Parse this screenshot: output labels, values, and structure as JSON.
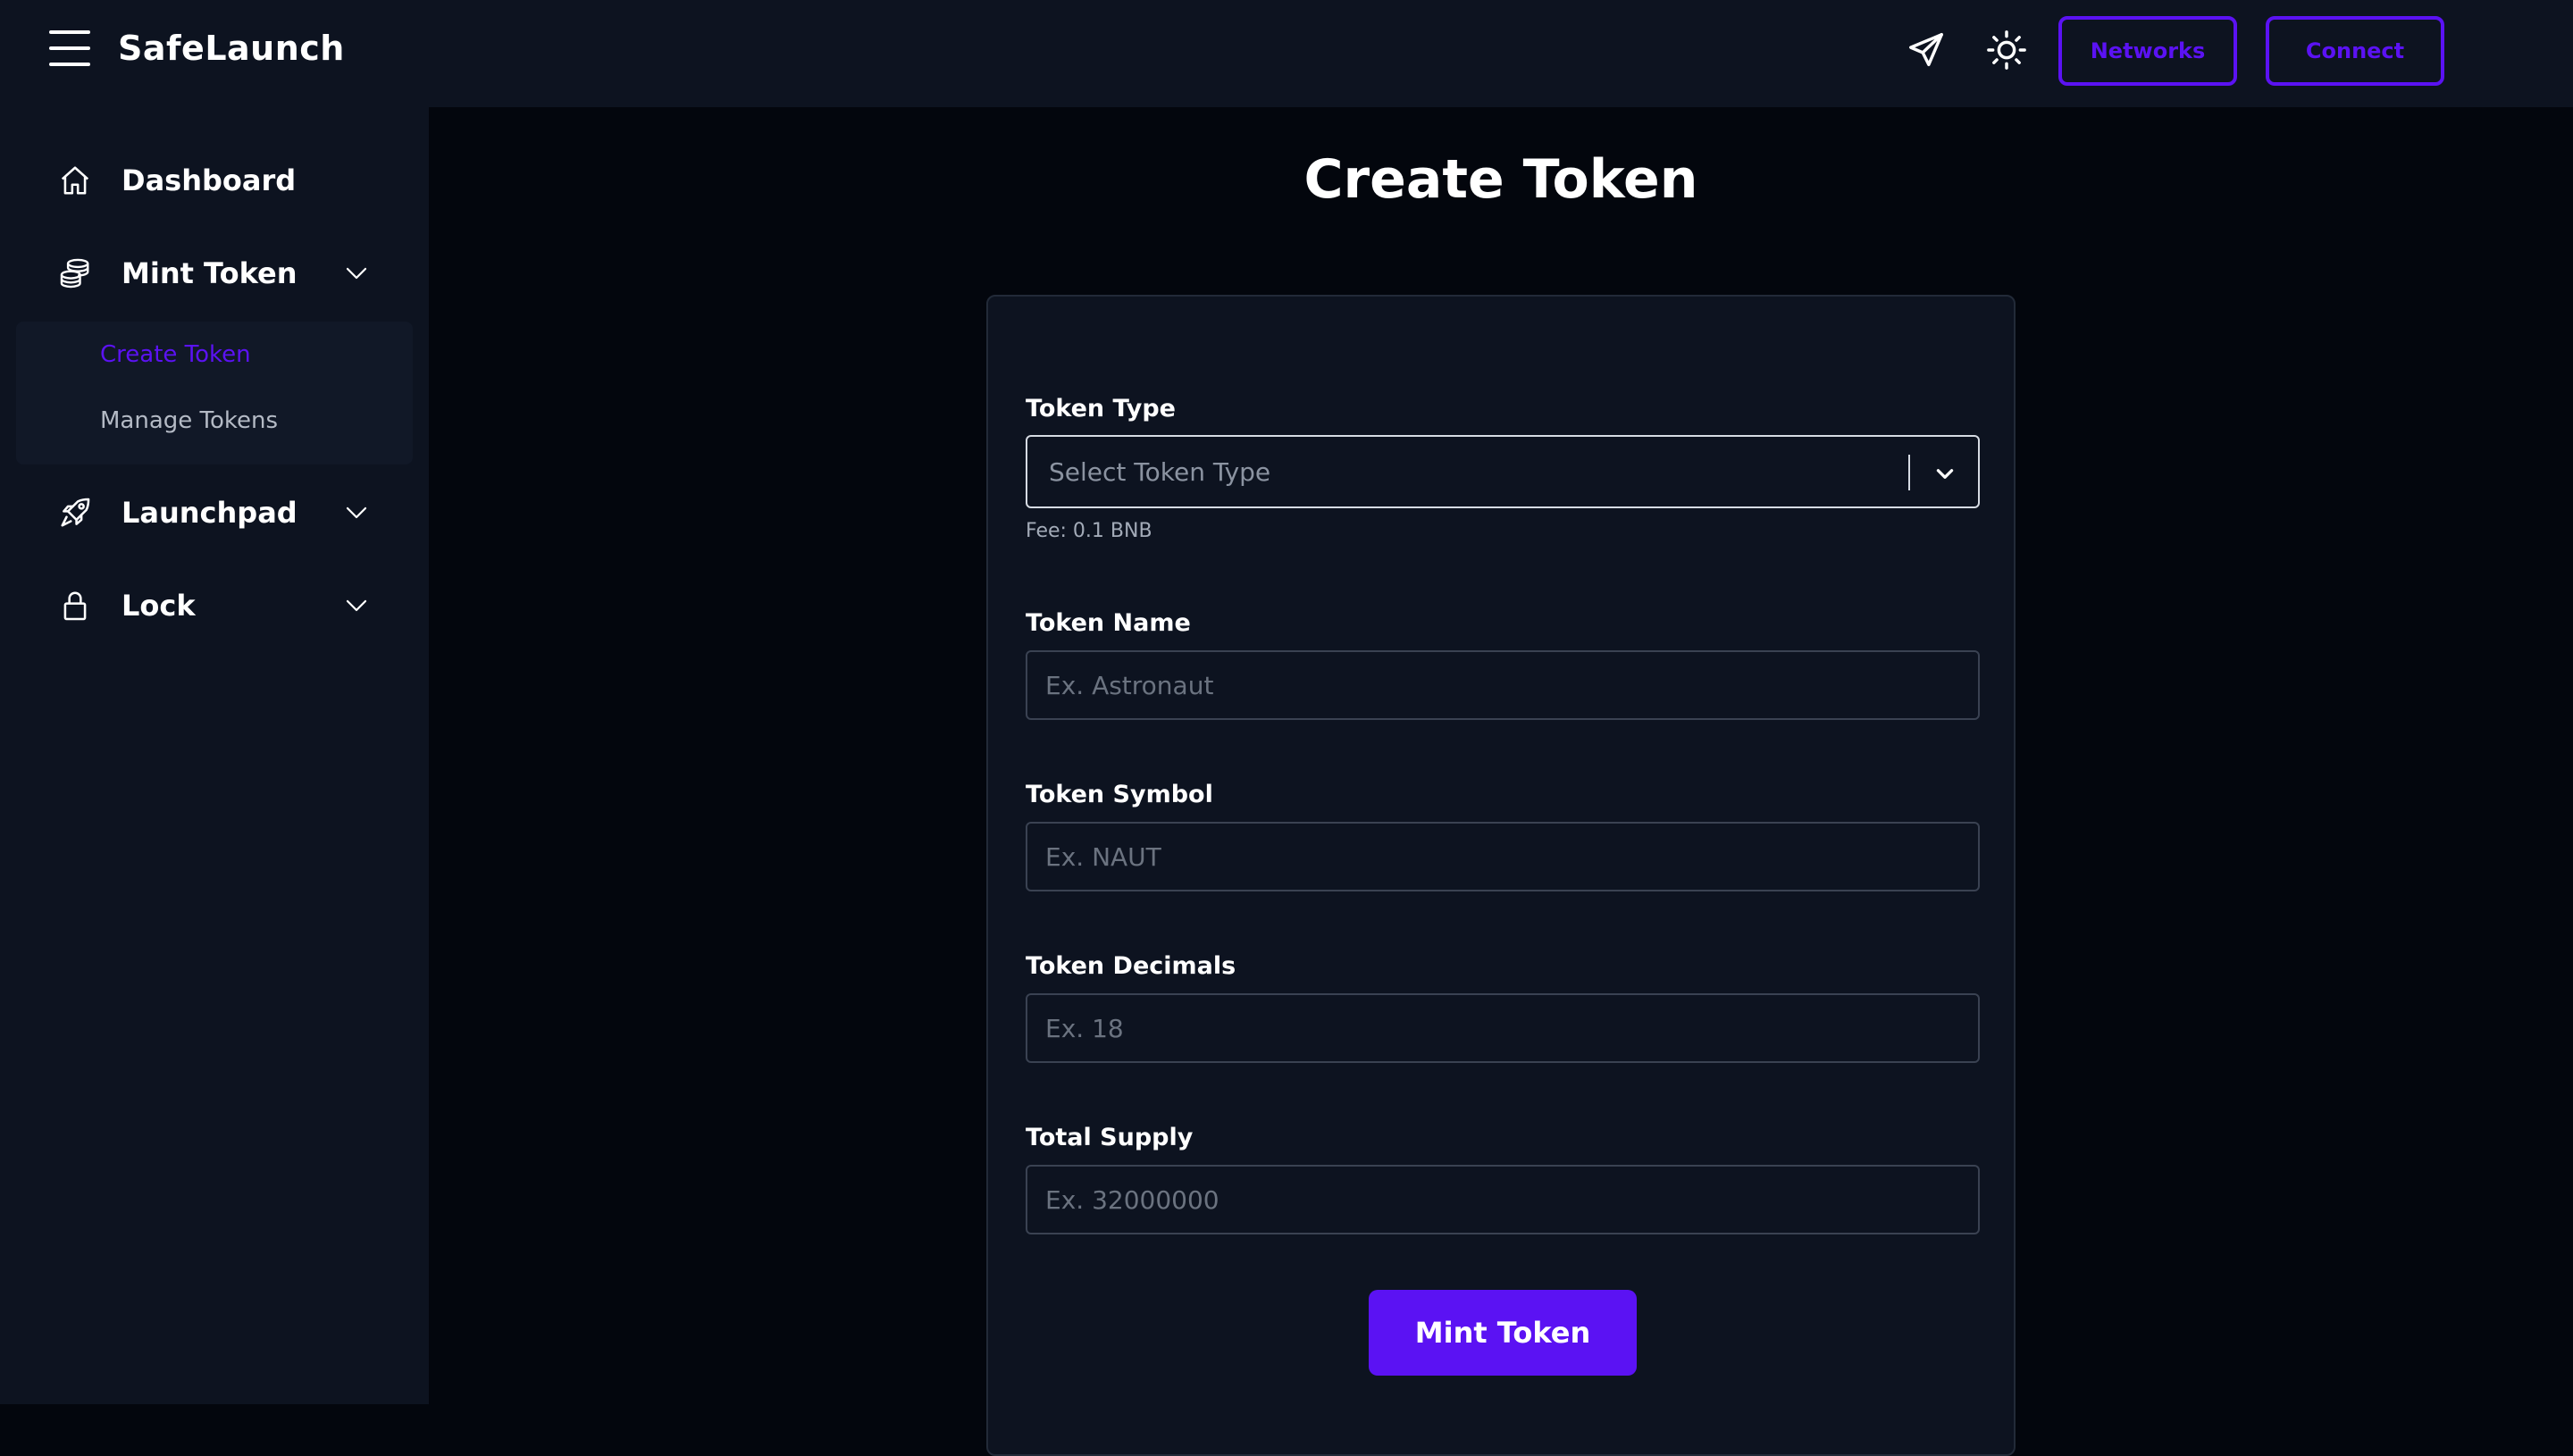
{
  "app": {
    "brand": "SafeLaunch"
  },
  "topbar": {
    "networks_label": "Networks",
    "connect_label": "Connect",
    "icons": [
      "menu-icon",
      "telegram-icon",
      "sun-icon"
    ]
  },
  "sidebar": {
    "items": [
      {
        "label": "Dashboard",
        "icon": "home-icon"
      },
      {
        "label": "Mint Token",
        "icon": "coins-icon",
        "expanded": true,
        "children": [
          {
            "label": "Create Token",
            "active": true
          },
          {
            "label": "Manage Tokens",
            "active": false
          }
        ]
      },
      {
        "label": "Launchpad",
        "icon": "rocket-icon"
      },
      {
        "label": "Lock",
        "icon": "lock-icon"
      }
    ]
  },
  "page": {
    "title": "Create Token"
  },
  "form": {
    "token_type": {
      "label": "Token Type",
      "placeholder": "Select Token Type",
      "fee": "Fee: 0.1 BNB"
    },
    "token_name": {
      "label": "Token Name",
      "placeholder": "Ex. Astronaut",
      "value": ""
    },
    "token_symbol": {
      "label": "Token Symbol",
      "placeholder": "Ex. NAUT",
      "value": ""
    },
    "token_decimals": {
      "label": "Token Decimals",
      "placeholder": "Ex. 18",
      "value": ""
    },
    "total_supply": {
      "label": "Total Supply",
      "placeholder": "Ex. 32000000",
      "value": ""
    },
    "submit_label": "Mint Token"
  },
  "colors": {
    "accent": "#5b12f3",
    "panel": "#0d1320",
    "background": "#03060d",
    "active_link": "#5b12f3",
    "muted_text": "#a3abb8"
  }
}
